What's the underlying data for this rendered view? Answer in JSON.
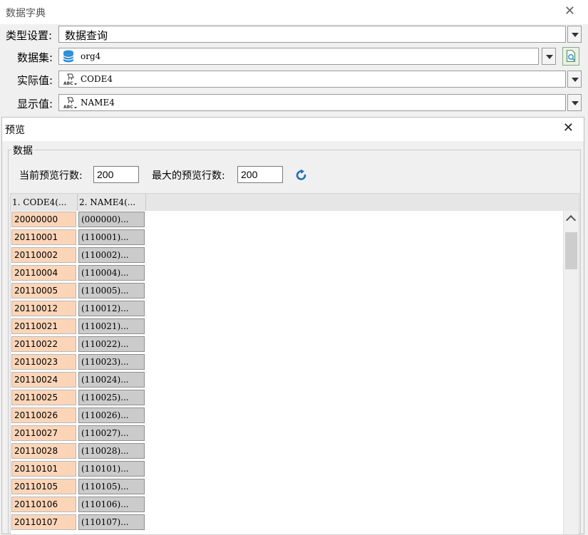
{
  "dialog": {
    "title": "数据字典",
    "type_label": "类型设置:",
    "type_value": "数据查询",
    "dataset_label": "数据集:",
    "dataset_value": "org4",
    "actual_label": "实际值:",
    "actual_value": "CODE4",
    "display_label": "显示值:",
    "display_value": "NAME4",
    "close_glyph": "✕"
  },
  "preview": {
    "title": "预览",
    "close_glyph": "✕",
    "group_label": "数据",
    "current_rows_label": "当前预览行数:",
    "current_rows_value": "200",
    "max_rows_label": "最大的预览行数:",
    "max_rows_value": "200",
    "columns": [
      "1. CODE4(...",
      "2. NAME4(..."
    ],
    "rows": [
      [
        "20000000",
        "(000000)..."
      ],
      [
        "20110001",
        "(110001)..."
      ],
      [
        "20110002",
        "(110002)..."
      ],
      [
        "20110004",
        "(110004)..."
      ],
      [
        "20110005",
        "(110005)..."
      ],
      [
        "20110012",
        "(110012)..."
      ],
      [
        "20110021",
        "(110021)..."
      ],
      [
        "20110022",
        "(110022)..."
      ],
      [
        "20110023",
        "(110023)..."
      ],
      [
        "20110024",
        "(110024)..."
      ],
      [
        "20110025",
        "(110025)..."
      ],
      [
        "20110026",
        "(110026)..."
      ],
      [
        "20110027",
        "(110027)..."
      ],
      [
        "20110028",
        "(110028)..."
      ],
      [
        "20110101",
        "(110101)..."
      ],
      [
        "20110105",
        "(110105)..."
      ],
      [
        "20110106",
        "(110106)..."
      ],
      [
        "20110107",
        "(110107)..."
      ]
    ]
  },
  "icons": {
    "dataset": "database-icon",
    "field": "abc-field-icon",
    "preview": "preview-search-icon",
    "refresh": "refresh-icon"
  },
  "colors": {
    "code_cell": "#fcd5b8",
    "name_cell": "#cbcbcb",
    "refresh": "#1f6fb5",
    "database": "#2d8fd8"
  }
}
